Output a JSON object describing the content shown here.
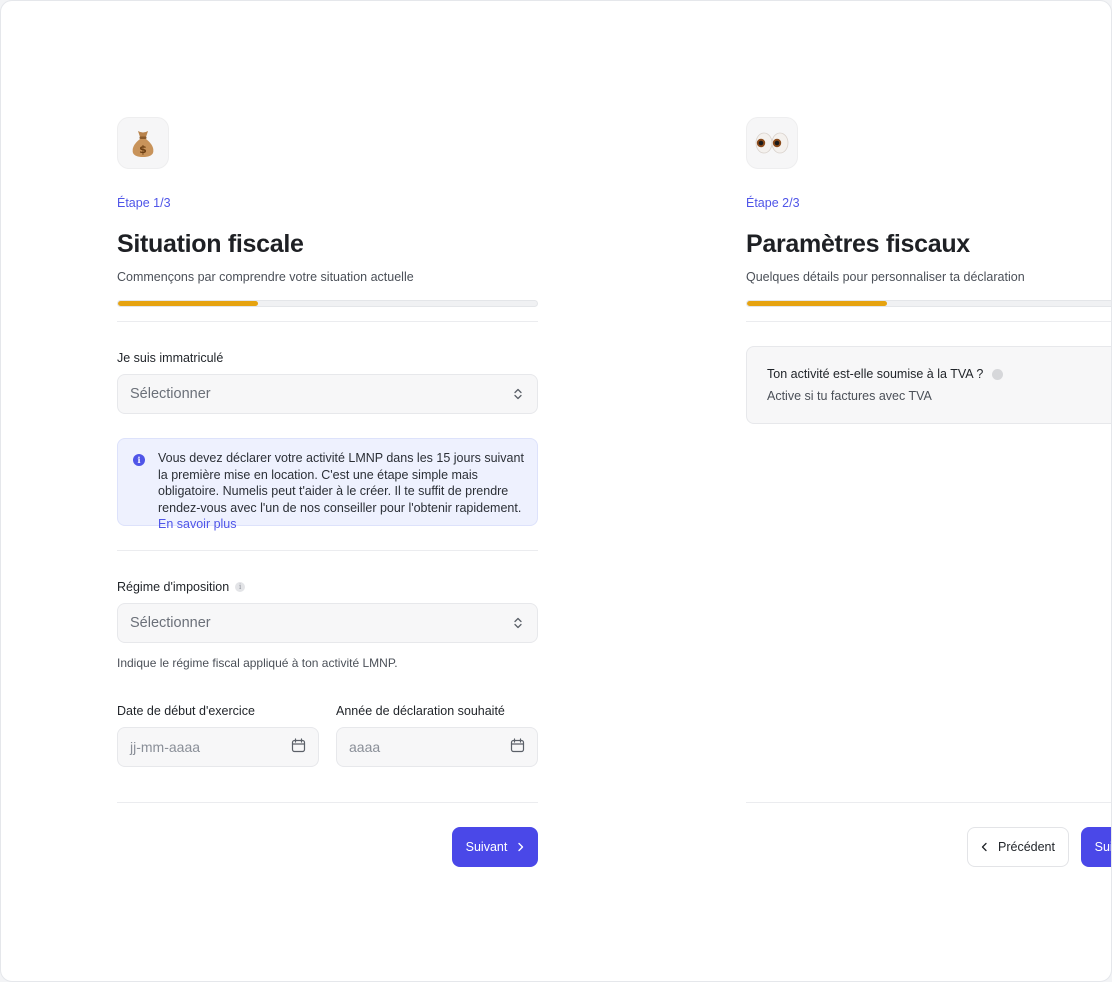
{
  "step1": {
    "emoji": "💰",
    "step_label": "Étape 1/3",
    "title": "Situation fiscale",
    "subtitle": "Commençons par comprendre votre situation actuelle",
    "progress": 0.333,
    "immatricule_label": "Je suis immatriculé",
    "immatricule_placeholder": "Sélectionner",
    "info_text": "Vous devez déclarer votre activité LMNP dans les 15 jours suivant la première mise en location. C'est une étape simple mais obligatoire. Numelis peut t'aider à le créer. Il te suffit de prendre rendez-vous avec l'un de nos conseiller pour l'obtenir rapidement.",
    "info_link": "En savoir plus",
    "regime_label": "Régime d'imposition",
    "regime_placeholder": "Sélectionner",
    "regime_hint": "Indique le régime fiscal appliqué à ton activité LMNP.",
    "date_label": "Date de début d'exercice",
    "date_placeholder": "jj-mm-aaaa",
    "year_label": "Année de déclaration souhaité",
    "year_placeholder": "aaaa",
    "next_button": "Suivant"
  },
  "step2": {
    "emoji": "👀",
    "step_label": "Étape 2/3",
    "title": "Paramètres fiscaux",
    "subtitle": "Quelques détails pour personnaliser ta déclaration",
    "progress": 0.333,
    "tva_question": "Ton activité est-elle soumise à la TVA ?",
    "tva_hint": "Active si tu factures avec TVA",
    "prev_button": "Précédent",
    "next_button": "Suivant"
  },
  "colors": {
    "accent": "#4a48e8",
    "progress": "#e6a310",
    "info_bg": "#eef1fe"
  }
}
